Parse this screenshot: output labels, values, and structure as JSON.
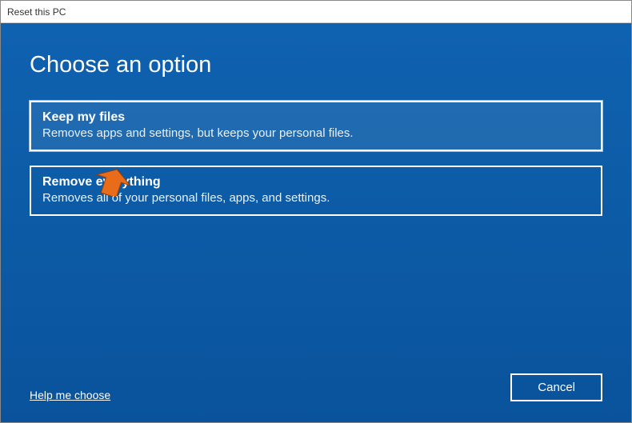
{
  "window": {
    "title": "Reset this PC"
  },
  "page": {
    "heading": "Choose an option"
  },
  "options": [
    {
      "title": "Keep my files",
      "description": "Removes apps and settings, but keeps your personal files."
    },
    {
      "title": "Remove everything",
      "description": "Removes all of your personal files, apps, and settings."
    }
  ],
  "footer": {
    "help_link": "Help me choose",
    "cancel_label": "Cancel"
  },
  "annotation": {
    "pointer_target": "keep-my-files-option"
  },
  "colors": {
    "background": "#0a5aa8",
    "border": "#ffffff",
    "text": "#ffffff",
    "pointer": "#e86c1a"
  }
}
